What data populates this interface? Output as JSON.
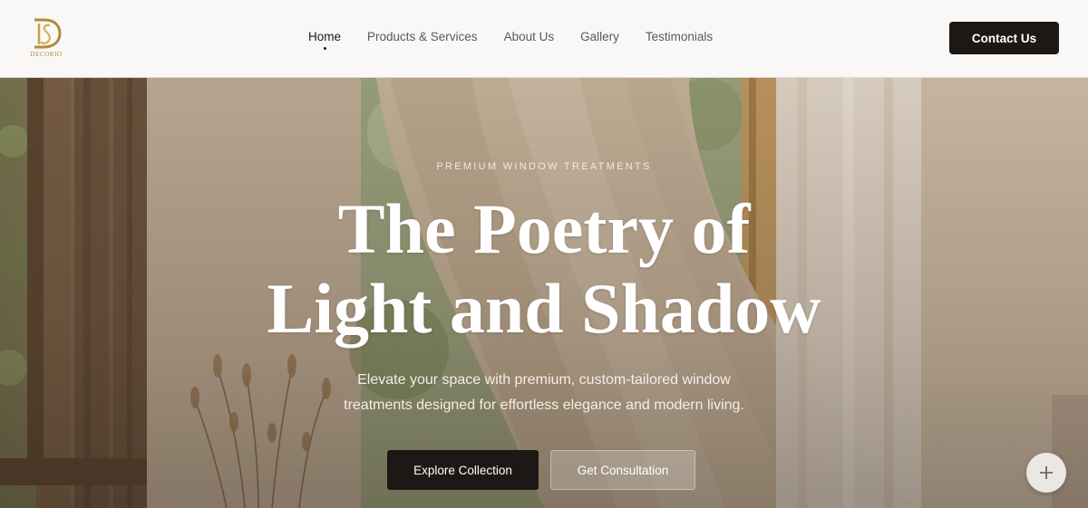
{
  "brand": {
    "logo_text": "DECORIO",
    "logo_color": "#b08a3e"
  },
  "nav": {
    "items": [
      {
        "label": "Home",
        "active": true
      },
      {
        "label": "Products & Services",
        "active": false
      },
      {
        "label": "About Us",
        "active": false
      },
      {
        "label": "Gallery",
        "active": false
      },
      {
        "label": "Testimonials",
        "active": false
      }
    ]
  },
  "header": {
    "contact_label": "Contact Us"
  },
  "hero": {
    "eyebrow": "PREMIUM WINDOW TREATMENTS",
    "headline_line1": "The Poetry of",
    "headline_line2": "Light and Shadow",
    "subtext_line1": "Elevate your space with premium, custom-tailored window",
    "subtext_line2": "treatments designed for effortless elegance and modern living.",
    "primary_cta": "Explore Collection",
    "secondary_cta": "Get Consultation"
  },
  "fab": {
    "icon": "plus-icon"
  },
  "colors": {
    "primary_button": "#1c1816",
    "header_bg": "#f9f8f6"
  }
}
